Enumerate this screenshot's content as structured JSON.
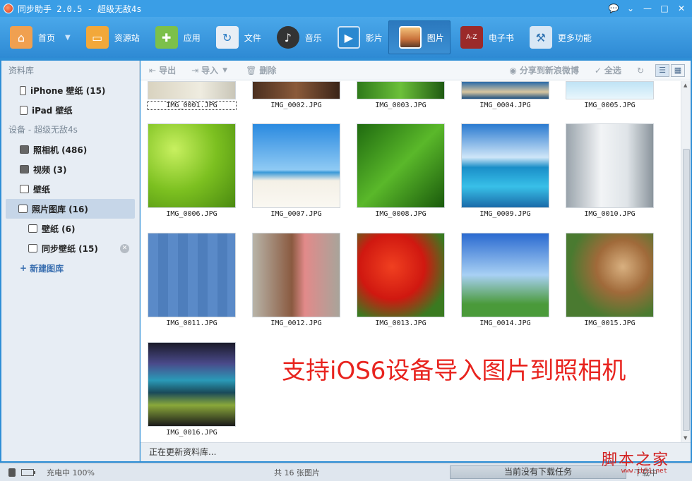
{
  "window": {
    "title": "同步助手 2.0.5 - 超级无敌4s",
    "controls": [
      "💬",
      "⌄",
      "—",
      "□",
      "✕"
    ]
  },
  "toolbar": {
    "items": [
      {
        "label": "首页",
        "icon": "home-icon",
        "color": "#f0a050"
      },
      {
        "label": "资源站",
        "icon": "shopping-bag-icon",
        "color": "#f2a83a"
      },
      {
        "label": "应用",
        "icon": "apps-icon",
        "color": "#7cc04a"
      },
      {
        "label": "文件",
        "icon": "folder-refresh-icon",
        "color": "#e8eef5"
      },
      {
        "label": "音乐",
        "icon": "music-note-icon",
        "color": "#333333"
      },
      {
        "label": "影片",
        "icon": "play-icon",
        "color": "#2a88d0"
      },
      {
        "label": "图片",
        "icon": "photo-icon",
        "color": "#e79048"
      },
      {
        "label": "电子书",
        "icon": "ebook-icon",
        "color": "#9b2a2a"
      },
      {
        "label": "更多功能",
        "icon": "tools-icon",
        "color": "#d8e7f5"
      }
    ],
    "active_label": "图片"
  },
  "sidebar": {
    "library_heading": "资料库",
    "library_items": [
      {
        "label": "iPhone 壁纸 (15)",
        "icon": "phone-icon"
      },
      {
        "label": "iPad 壁纸",
        "icon": "tablet-icon"
      }
    ],
    "device_heading": "设备 - 超级无敌4s",
    "device_items": [
      {
        "label": "照相机 (486)",
        "icon": "camera-icon"
      },
      {
        "label": "视频 (3)",
        "icon": "video-icon"
      },
      {
        "label": "壁纸",
        "icon": "wallpaper-icon"
      },
      {
        "label": "照片图库 (16)",
        "icon": "gallery-icon"
      }
    ],
    "gallery_children": [
      {
        "label": "壁纸 (6)",
        "icon": "album-icon"
      },
      {
        "label": "同步壁纸 (15)",
        "icon": "album-icon"
      }
    ],
    "new_gallery": "新建图库"
  },
  "content": {
    "actions": {
      "export": "导出",
      "import": "导入",
      "delete": "删除",
      "share": "分享到新浪微博",
      "select_all": "全选"
    },
    "images": [
      "IMG_0001.JPG",
      "IMG_0002.JPG",
      "IMG_0003.JPG",
      "IMG_0004.JPG",
      "IMG_0005.JPG",
      "IMG_0006.JPG",
      "IMG_0007.JPG",
      "IMG_0008.JPG",
      "IMG_0009.JPG",
      "IMG_0010.JPG",
      "IMG_0011.JPG",
      "IMG_0012.JPG",
      "IMG_0013.JPG",
      "IMG_0014.JPG",
      "IMG_0015.JPG",
      "IMG_0016.JPG"
    ],
    "promo_text": "支持iOS6设备导入图片到照相机",
    "status_text": "正在更新资料库..."
  },
  "statusbar": {
    "charge_text": "充电中 100%",
    "count_text": "共 16 张图片",
    "download_text": "当前没有下载任务",
    "download_right": "下载中"
  },
  "watermark": {
    "main": "脚本之家",
    "sub": "www.jb51.net"
  }
}
